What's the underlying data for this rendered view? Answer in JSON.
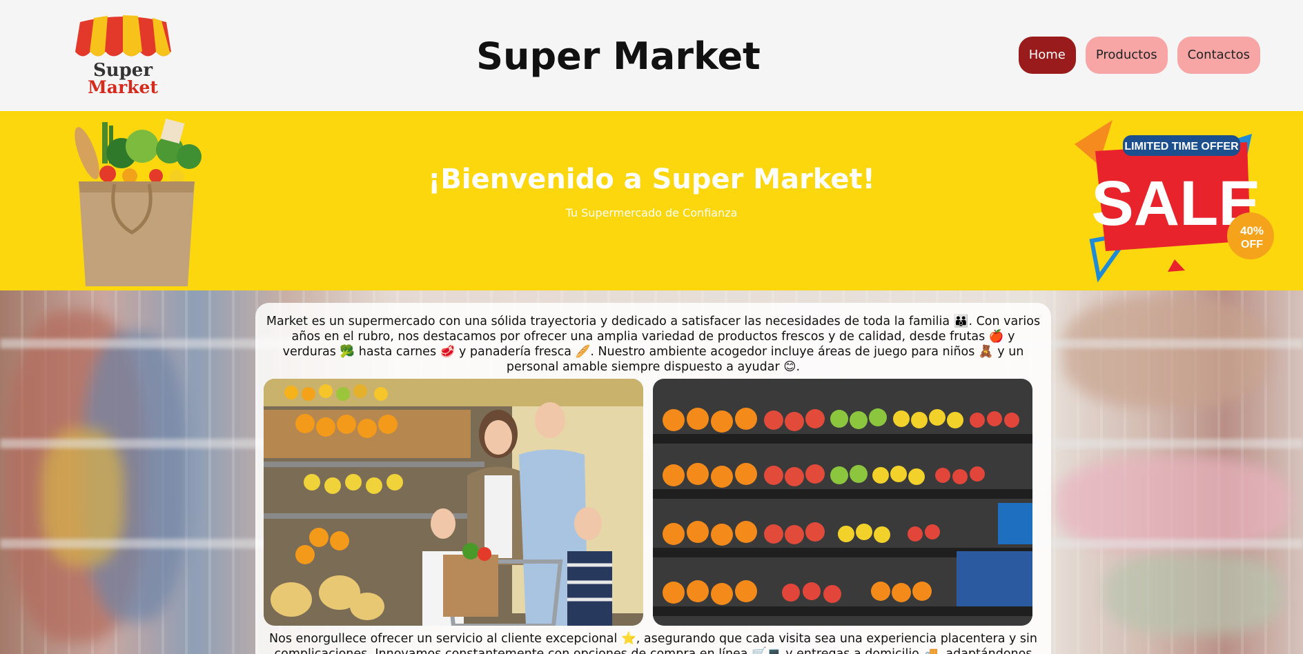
{
  "header": {
    "logo_line1": "Super",
    "logo_line2": "Market",
    "title": "Super Market",
    "nav": [
      {
        "label": "Home",
        "active": true
      },
      {
        "label": "Productos",
        "active": false
      },
      {
        "label": "Contactos",
        "active": false
      }
    ]
  },
  "hero": {
    "title": "¡Bienvenido a Super Market!",
    "subtitle": "Tu Supermercado de Confianza",
    "sale": {
      "ribbon": "LIMITED TIME OFFER",
      "word": "SALE",
      "badge_line1": "40%",
      "badge_line2": "OFF"
    }
  },
  "content": {
    "intro": "Market es un supermercado con una sólida trayectoria y dedicado a satisfacer las necesidades de toda la familia 👪. Con varios años en el rubro, nos destacamos por ofrecer una amplia variedad de productos frescos y de calidad, desde frutas 🍎 y verduras 🥦 hasta carnes 🥩 y panadería fresca 🥖. Nuestro ambiente acogedor incluye áreas de juego para niños 🧸 y un personal amable siempre dispuesto a ayudar 😊.",
    "service": "Nos enorgullece ofrecer un servicio al cliente excepcional ⭐, asegurando que cada visita sea una experiencia placentera y sin complicaciones. Innovamos constantemente con opciones de compra en línea 🛒💻 y entregas a domicilio 🚚, adaptándonos para"
  },
  "colors": {
    "hero_bg": "#fdd70d",
    "nav_active": "#9a1b1b",
    "nav_inactive": "#f8a5a5",
    "awning_red": "#e2392b",
    "awning_yellow": "#f7c21a"
  }
}
